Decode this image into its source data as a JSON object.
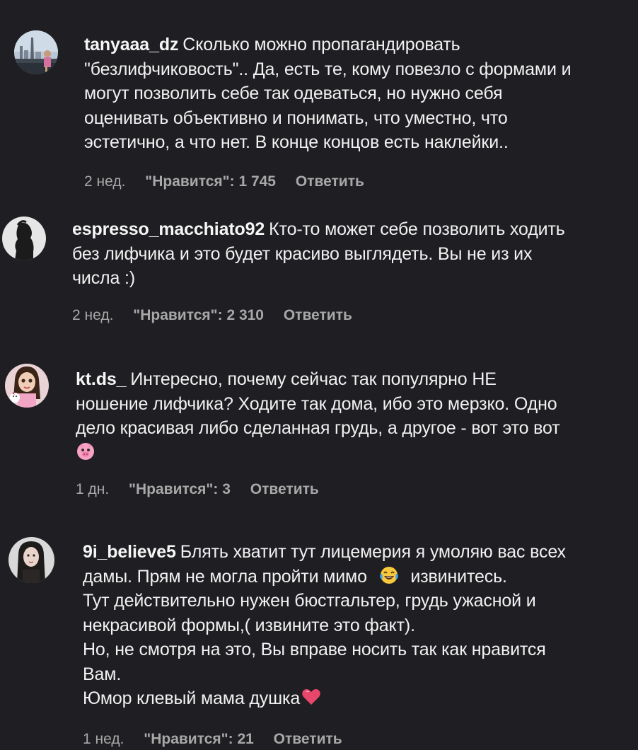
{
  "comments": [
    {
      "username": "tanyaaa_dz",
      "lines": [
        "Сколько можно пропагандировать",
        "\"безлифчиковость\".. Да, есть те, кому повезло с формами и",
        "могут позволить себе так одеваться, но нужно себя",
        "оценивать объективно и понимать, что уместно, что",
        "эстетично, а что нет. В конце концов есть наклейки.."
      ],
      "time": "2 нед.",
      "likes": "\"Нравится\": 1 745",
      "reply": "Ответить",
      "avatar_icon": "city-photo-avatar"
    },
    {
      "username": "espresso_macchiato92",
      "lines": [
        "Кто-то может себе позволить ходить",
        "без лифчика и это будет красиво выглядеть. Вы не из их",
        "числа :)"
      ],
      "time": "2 нед.",
      "likes": "\"Нравится\": 2 310",
      "reply": "Ответить",
      "avatar_icon": "silhouette-avatar"
    },
    {
      "username": "kt.ds_",
      "lines": [
        "Интересно, почему сейчас так популярно НЕ",
        "ношение лифчика? Ходите так дома, ибо это мерзко. Одно",
        "дело красивая либо сделанная грудь, а другое - вот это вот"
      ],
      "emoji_line": "pig-face-emoji",
      "time": "1 дн.",
      "likes": "\"Нравится\": 3",
      "reply": "Ответить",
      "avatar_icon": "doll-avatar"
    },
    {
      "username": "9i_believe5",
      "line1": "Блять хватит тут лицемерия я умоляю вас всех",
      "line2_a": "дамы. Прям не могла пройти мимо",
      "line2_emoji": "laughing-tears-emoji",
      "line2_b": "извинитесь.",
      "line3": "Тут действительно нужен бюстгальтер, грудь ужасной и",
      "line4": "некрасивой формы,( извините это факт).",
      "line5": "Но, не смотря на это, Вы вправе носить так как нравится",
      "line6": "Вам.",
      "line7": "Юмор клевый мама душка",
      "line7_emoji": "heart-emoji",
      "time": "1 нед.",
      "likes": "\"Нравится\": 21",
      "reply": "Ответить",
      "avatar_icon": "girl-photo-avatar"
    }
  ],
  "colors": {
    "background": "#1f1f23",
    "text": "#f1f1f1",
    "meta": "#a8a8a8"
  }
}
